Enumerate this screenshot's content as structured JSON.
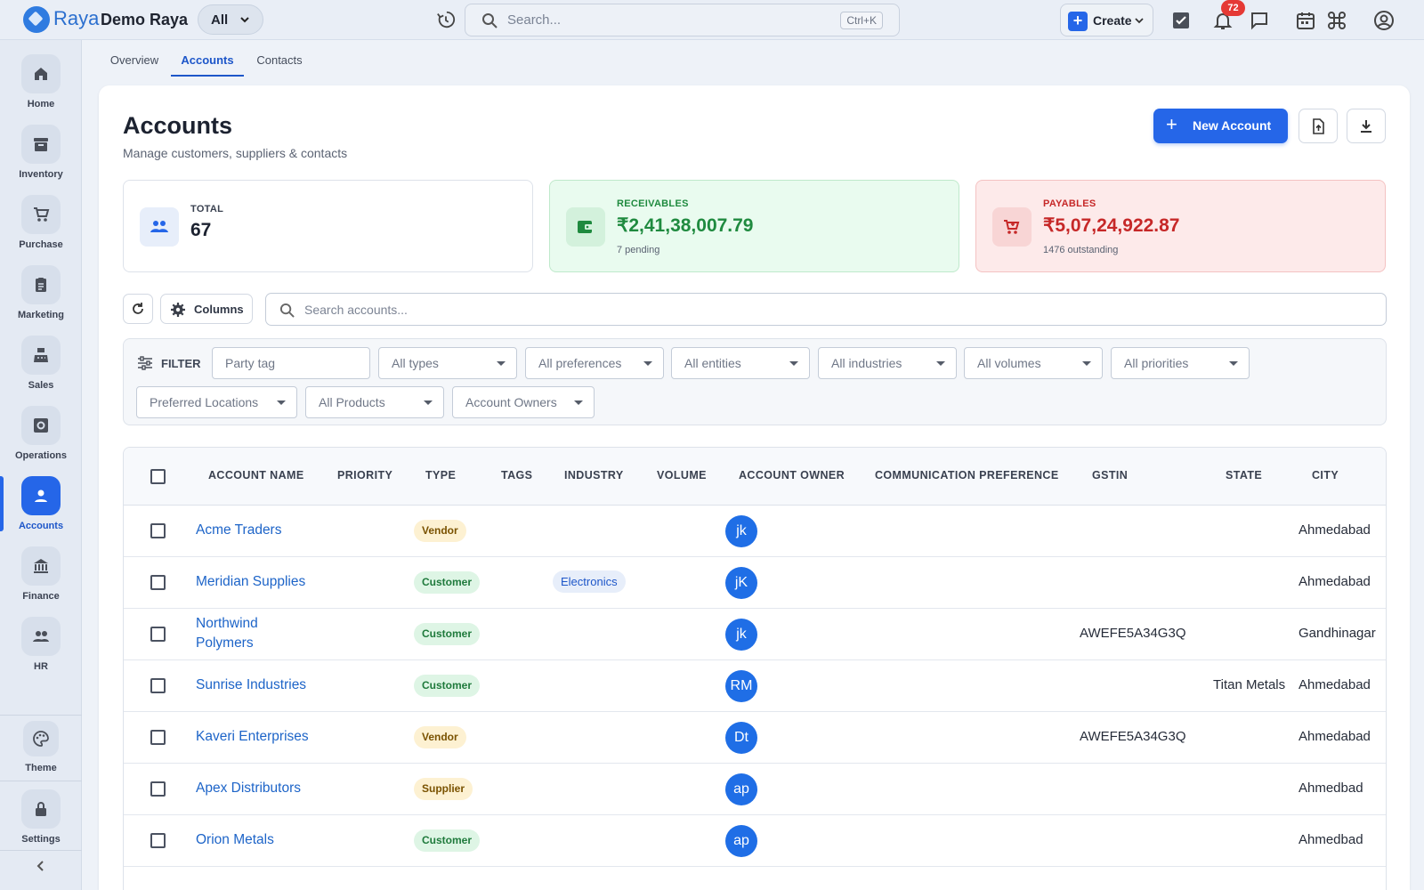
{
  "topbar": {
    "brand": "Raya",
    "org": "Demo Raya",
    "scope": "All",
    "search_placeholder": "Search...",
    "search_shortcut": "Ctrl+K",
    "create_label": "Create",
    "notifications_count": "72",
    "icons": [
      "history-icon",
      "search-icon",
      "tasks-icon",
      "bell-icon",
      "chat-icon",
      "calendar-icon",
      "command-icon",
      "account-circle-icon"
    ]
  },
  "sidebar": {
    "items": [
      {
        "label": "Home",
        "icon": "home-icon"
      },
      {
        "label": "Inventory",
        "icon": "inventory-icon"
      },
      {
        "label": "Purchase",
        "icon": "cart-icon"
      },
      {
        "label": "Marketing",
        "icon": "clipboard-icon"
      },
      {
        "label": "Sales",
        "icon": "register-icon"
      },
      {
        "label": "Operations",
        "icon": "gear-box-icon"
      },
      {
        "label": "Accounts",
        "icon": "person-icon",
        "active": true
      },
      {
        "label": "Finance",
        "icon": "bank-icon"
      },
      {
        "label": "HR",
        "icon": "people-icon"
      }
    ],
    "theme_label": "Theme",
    "settings_label": "Settings"
  },
  "tabs": [
    "Overview",
    "Accounts",
    "Contacts"
  ],
  "active_tab": "Accounts",
  "page": {
    "title": "Accounts",
    "subtitle": "Manage customers, suppliers & contacts",
    "new_button": "New Account"
  },
  "stats": {
    "total": {
      "label": "TOTAL",
      "value": "67"
    },
    "receivables": {
      "label": "RECEIVABLES",
      "value": "₹2,41,38,007.79",
      "sub": "7 pending"
    },
    "payables": {
      "label": "PAYABLES",
      "value": "₹5,07,24,922.87",
      "sub": "1476 outstanding"
    }
  },
  "toolbar": {
    "columns_label": "Columns",
    "search_placeholder": "Search accounts..."
  },
  "filters": {
    "label": "FILTER",
    "party_tag_placeholder": "Party tag",
    "selects": [
      "All types",
      "All preferences",
      "All entities",
      "All industries",
      "All volumes",
      "All priorities",
      "Preferred Locations",
      "All Products",
      "Account Owners"
    ]
  },
  "table": {
    "columns": [
      "ACCOUNT NAME",
      "PRIORITY",
      "TYPE",
      "TAGS",
      "INDUSTRY",
      "VOLUME",
      "ACCOUNT OWNER",
      "COMMUNICATION PREFERENCE",
      "GSTIN",
      "STATE",
      "CITY"
    ],
    "rows": [
      {
        "name": "Acme Traders",
        "name2": "",
        "type": "Vendor",
        "industry": "",
        "owner": "jk",
        "gstin": "",
        "state": "",
        "city": "Ahmedabad"
      },
      {
        "name": "Meridian Supplies",
        "name2": "",
        "type": "Customer",
        "industry": "Electronics",
        "owner": "jK",
        "gstin": "",
        "state": "",
        "city": "Ahmedabad"
      },
      {
        "name": "Northwind",
        "name2": "Polymers",
        "type": "Customer",
        "industry": "",
        "owner": "jk",
        "gstin": "AWEFE5A34G3Q",
        "state": "",
        "city": "Gandhinagar"
      },
      {
        "name": "Sunrise Industries",
        "name2": "",
        "type": "Customer",
        "industry": "",
        "owner": "RM",
        "gstin": "",
        "state": "Titan Metals",
        "city": "Ahmedabad"
      },
      {
        "name": "Kaveri Enterprises",
        "name2": "",
        "type": "Vendor",
        "industry": "",
        "owner": "Dt",
        "gstin": "AWEFE5A34G3Q",
        "state": "",
        "city": "Ahmedabad"
      },
      {
        "name": "Apex Distributors",
        "name2": "",
        "type": "Supplier",
        "industry": "",
        "owner": "ap",
        "gstin": "",
        "state": "",
        "city": "Ahmedbad"
      },
      {
        "name": "Orion Metals",
        "name2": "",
        "type": "Customer",
        "industry": "",
        "owner": "ap",
        "gstin": "",
        "state": "",
        "city": "Ahmedbad"
      }
    ]
  },
  "colors": {
    "accent": "#2566e8",
    "receivables_bg": "#e9fbef",
    "payables_bg": "#fdeaea",
    "receivables_text": "#1f8a3f",
    "payables_text": "#c62828"
  }
}
